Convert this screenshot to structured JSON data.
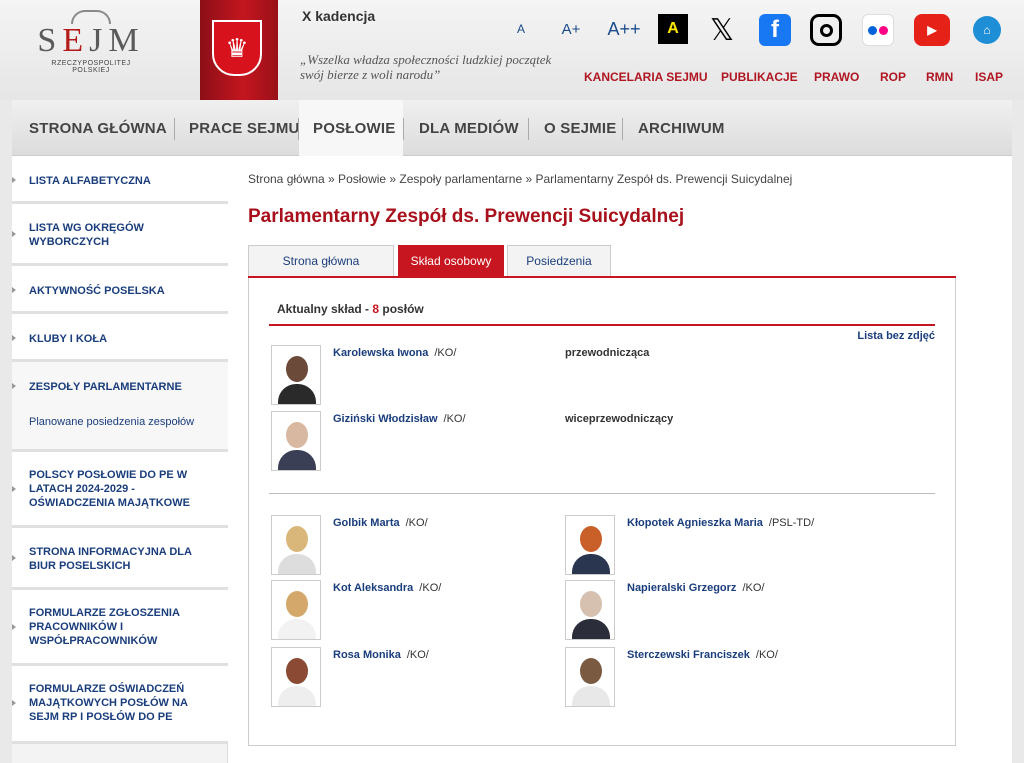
{
  "header": {
    "logo_text": "SEJM",
    "logo_sub": "RZECZYPOSPOLITEJ POLSKIEJ",
    "kadencja": "X kadencja",
    "motto": "„Wszelka władza społeczności ludzkiej początek swój bierze z woli narodu”",
    "font_small": "A",
    "font_medium": "A+",
    "font_large": "A++",
    "contrast": "A",
    "social": [
      {
        "name": "x",
        "color": "#ffffff"
      },
      {
        "name": "facebook",
        "color": "#1877f2"
      },
      {
        "name": "instagram",
        "color": "#ffffff"
      },
      {
        "name": "flickr",
        "color": "#ffffff"
      },
      {
        "name": "youtube",
        "color": "#e62117"
      },
      {
        "name": "bip",
        "color": "#1e8fd6"
      }
    ],
    "top_links": [
      "KANCELARIA SEJMU",
      "PUBLIKACJE",
      "PRAWO",
      "ROP",
      "RMN",
      "ISAP"
    ]
  },
  "nav": [
    "STRONA GŁÓWNA",
    "PRACE SEJMU",
    "POSŁOWIE",
    "DLA MEDIÓW",
    "O SEJMIE",
    "ARCHIWUM"
  ],
  "sidebar": [
    "LISTA ALFABETYCZNA",
    "LISTA WG OKRĘGÓW WYBORCZYCH",
    "AKTYWNOŚĆ POSELSKA",
    "KLUBY I KOŁA",
    "ZESPOŁY PARLAMENTARNE",
    "Planowane posiedzenia zespołów",
    "POLSCY POSŁOWIE DO PE W LATACH 2024-2029 - OŚWIADCZENIA MAJĄTKOWE",
    "STRONA INFORMACYJNA DLA BIUR POSELSKICH",
    "FORMULARZE ZGŁOSZENIA PRACOWNIKÓW I WSPÓŁPRACOWNIKÓW",
    "FORMULARZE OŚWIADCZEŃ MAJĄTKOWYCH POSŁÓW NA SEJM RP I POSŁÓW DO PE"
  ],
  "breadcrumb": "Strona główna » Posłowie » Zespoły parlamentarne » Parlamentarny Zespół ds. Prewencji Suicydalnej",
  "title": "Parlamentarny Zespół ds. Prewencji Suicydalnej",
  "tabs": [
    "Strona główna",
    "Skład osobowy",
    "Posiedzenia"
  ],
  "composition": {
    "label": "Aktualny skład - ",
    "count": "8",
    "suffix": " posłów"
  },
  "no_photo_link": "Lista bez zdjęć",
  "leaders": [
    {
      "name": "Karolewska Iwona",
      "club": "/KO/",
      "role": "przewodnicząca"
    },
    {
      "name": "Giziński Włodzisław",
      "club": "/KO/",
      "role": "wiceprzewodniczący"
    }
  ],
  "members": [
    {
      "name": "Golbik Marta",
      "club": "/KO/"
    },
    {
      "name": "Kłopotek Agnieszka Maria",
      "club": "/PSL-TD/"
    },
    {
      "name": "Kot Aleksandra",
      "club": "/KO/"
    },
    {
      "name": "Napieralski Grzegorz",
      "club": "/KO/"
    },
    {
      "name": "Rosa Monika",
      "club": "/KO/"
    },
    {
      "name": "Sterczewski Franciszek",
      "club": "/KO/"
    }
  ]
}
